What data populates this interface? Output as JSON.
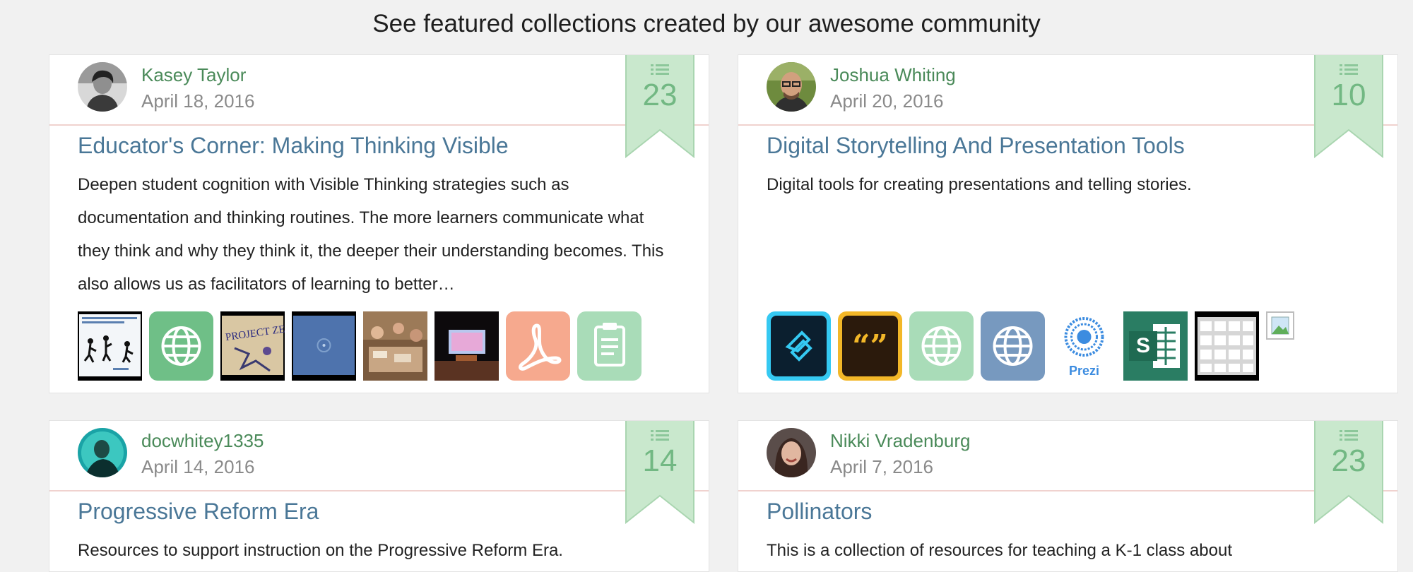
{
  "heading": "See featured collections created by our awesome community",
  "collections": [
    {
      "author": "Kasey Taylor",
      "date": "April 18, 2016",
      "count": "23",
      "title": "Educator's Corner: Making Thinking Visible",
      "description": "Deepen student cognition with Visible Thinking strategies such as documentation and thinking routines. The more learners communicate what they think and why they think it, the deeper their understanding becomes. This also allows us as facilitators of learning to better…",
      "resources": [
        "video-thumbnail",
        "globe-icon",
        "image-thumbnail",
        "video-thumbnail",
        "image-thumbnail",
        "image-thumbnail",
        "pdf-icon",
        "clipboard-icon"
      ]
    },
    {
      "author": "Joshua Whiting",
      "date": "April 20, 2016",
      "count": "10",
      "title": "Digital Storytelling And Presentation Tools",
      "description": "Digital tools for creating presentations and telling stories.",
      "resources": [
        "adobe-slate-icon",
        "adobe-voice-icon",
        "globe-icon",
        "globe-icon",
        "prezi-icon",
        "sway-icon",
        "grid-app-icon",
        "broken-image-icon"
      ],
      "prezi_label": "Prezi",
      "sway_letter": "S"
    },
    {
      "author": "docwhitey1335",
      "date": "April 14, 2016",
      "count": "14",
      "title": "Progressive Reform Era",
      "description": "Resources to support instruction on the Progressive Reform Era."
    },
    {
      "author": "Nikki Vradenburg",
      "date": "April 7, 2016",
      "count": "23",
      "title": "Pollinators",
      "description": "This is a collection of resources for teaching a K-1 class about"
    }
  ],
  "colors": {
    "author": "#4a8a59",
    "title": "#4a7797",
    "ribbon": "#c9e8cd",
    "ribbon_text": "#72b883",
    "rule": "#f0d2cf"
  }
}
